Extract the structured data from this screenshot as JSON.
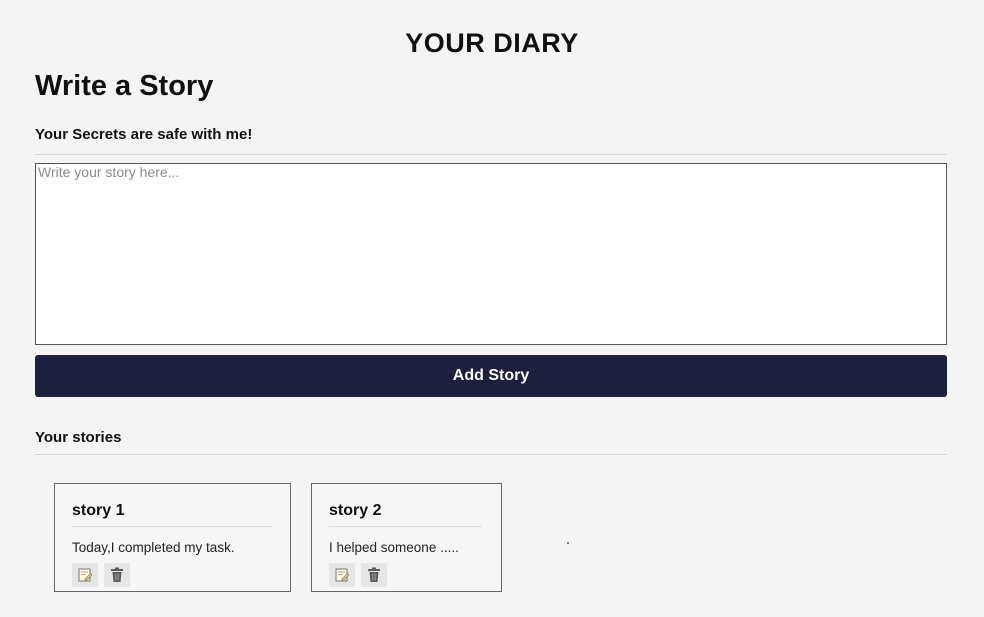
{
  "header": {
    "title": "YOUR DIARY"
  },
  "editor": {
    "heading": "Write a Story",
    "subtitle": "Your Secrets are safe with me!",
    "placeholder": "Write your story here...",
    "value": "",
    "add_button_label": "Add Story"
  },
  "stories": {
    "heading": "Your stories",
    "items": [
      {
        "title": "story 1",
        "text": "Today,I completed my task."
      },
      {
        "title": "story 2",
        "text": "I helped someone ....."
      }
    ],
    "actions": {
      "edit_icon": "edit-note-icon",
      "delete_icon": "trash-icon"
    }
  },
  "colors": {
    "background": "#f4f4f4",
    "button": "#1c1f3e",
    "button_text": "#ffffff",
    "card_border": "#666666",
    "edit_icon": "#e8c96a",
    "delete_icon": "#5a5a5a"
  }
}
